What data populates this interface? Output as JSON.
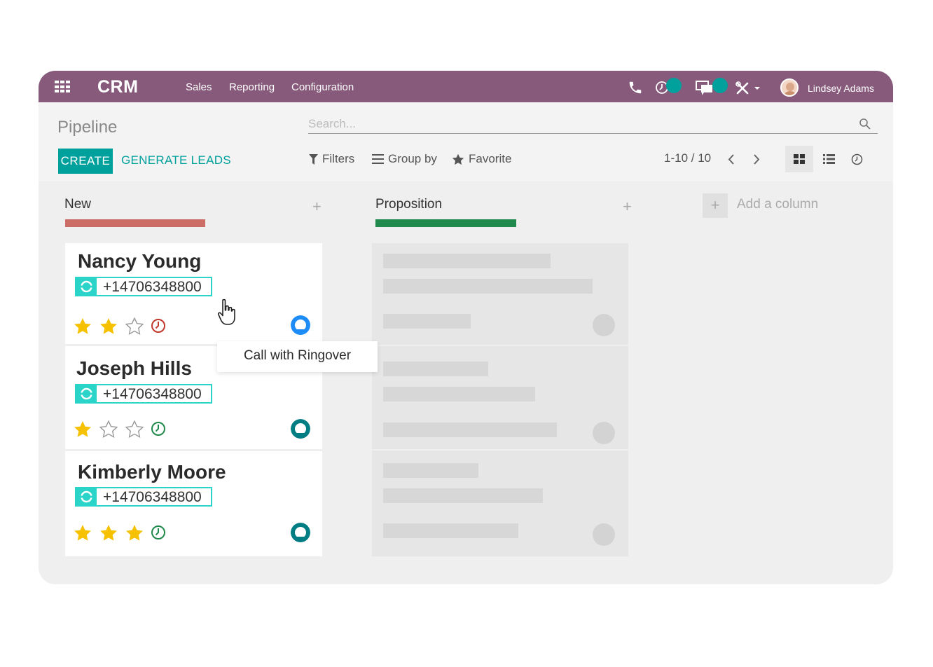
{
  "navbar": {
    "app_name": "CRM",
    "menu": [
      "Sales",
      "Reporting",
      "Configuration"
    ],
    "user_name": "Lindsey Adams",
    "brand_color": "#875a7b",
    "badge_color": "#00a09d",
    "icons": [
      "apps-grid-icon",
      "phone-icon",
      "activity-clock-icon",
      "chat-icon",
      "tools-icon"
    ]
  },
  "control": {
    "page_title": "Pipeline",
    "search_placeholder": "Search...",
    "create_label": "CREATE",
    "generate_label": "GENERATE LEADS",
    "filters_label": "Filters",
    "groupby_label": "Group by",
    "favorite_label": "Favorite",
    "pager": "1-10 / 10",
    "views": [
      "kanban-view",
      "list-view",
      "activity-view"
    ],
    "active_view": "kanban-view"
  },
  "columns": [
    {
      "title": "New",
      "bar_color": "#cc6e66"
    },
    {
      "title": "Proposition",
      "bar_color": "#1f8a4c"
    }
  ],
  "add_column_label": "Add a column",
  "cards": [
    {
      "name": "Nancy Young",
      "phone": "+14706348800",
      "stars": 2,
      "activity_color": "#c0392b",
      "avatar_color": "#1e8cf6"
    },
    {
      "name": "Joseph Hills",
      "phone": "+14706348800",
      "stars": 1,
      "activity_color": "#1f8a4c",
      "avatar_color": "#017e84"
    },
    {
      "name": "Kimberly Moore",
      "phone": "+14706348800",
      "stars": 3,
      "activity_color": "#1f8a4c",
      "avatar_color": "#017e84"
    }
  ],
  "tooltip": "Call with Ringover",
  "ringover_color": "#2ad4c8",
  "star_color": "#f6c100"
}
